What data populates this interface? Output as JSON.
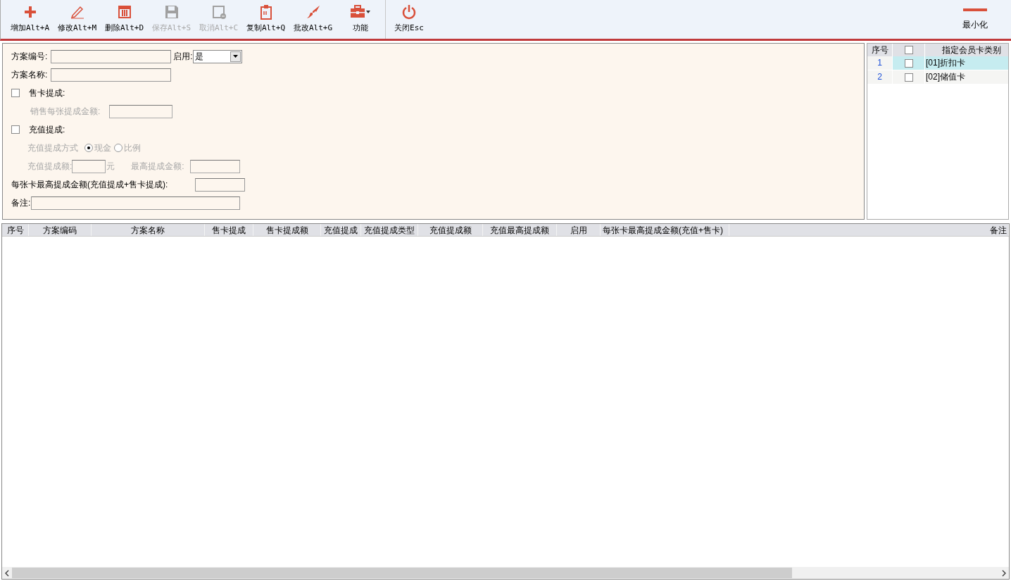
{
  "toolbar": [
    {
      "kind": "add",
      "label": "增加Alt+A",
      "disabled": false
    },
    {
      "kind": "edit",
      "label": "修改Alt+M",
      "disabled": false
    },
    {
      "kind": "delete",
      "label": "删除Alt+D",
      "disabled": false
    },
    {
      "kind": "save",
      "label": "保存Alt+S",
      "disabled": true
    },
    {
      "kind": "cancel",
      "label": "取消Alt+C",
      "disabled": true
    },
    {
      "kind": "copy",
      "label": "复制Alt+Q",
      "disabled": false
    },
    {
      "kind": "batch",
      "label": "批改Alt+G",
      "disabled": false
    },
    {
      "kind": "tools",
      "label": "功能",
      "disabled": false,
      "dropdown": true
    },
    {
      "kind": "close",
      "label": "关闭Esc",
      "disabled": false,
      "separator": true
    }
  ],
  "minimize": {
    "label": "最小化"
  },
  "form": {
    "scheme_no": {
      "label": "方案编号:"
    },
    "enabled": {
      "label": "启用:",
      "value": "是"
    },
    "scheme_name": {
      "label": "方案名称:"
    },
    "sell_card": {
      "label": "售卡提成:",
      "checked": false,
      "amount_label": "销售每张提成金额:"
    },
    "recharge": {
      "label": "充值提成:",
      "checked": false,
      "method_label": "充值提成方式",
      "methods": [
        {
          "label": "现金",
          "selected": true
        },
        {
          "label": "比例",
          "selected": false
        }
      ],
      "amount_label": "充值提成额:",
      "unit": "元",
      "max_label": "最高提成金额:"
    },
    "per_card_max": {
      "label": "每张卡最高提成金额(充值提成+售卡提成):"
    },
    "remark": {
      "label": "备注:"
    }
  },
  "card_types": {
    "columns": [
      "序号",
      "指定会员卡类别"
    ],
    "header_checked": false,
    "rows": [
      {
        "index": "1",
        "name": "[01]折扣卡",
        "checked": false,
        "selected": true
      },
      {
        "index": "2",
        "name": "[02]储值卡",
        "checked": false,
        "selected": false
      }
    ]
  },
  "table": {
    "columns": [
      "序号",
      "方案编码",
      "方案名称",
      "售卡提成",
      "售卡提成额",
      "充值提成",
      "充值提成类型",
      "充值提成额",
      "充值最高提成额",
      "启用",
      "每张卡最高提成金额(充值+售卡)",
      "备注"
    ]
  }
}
